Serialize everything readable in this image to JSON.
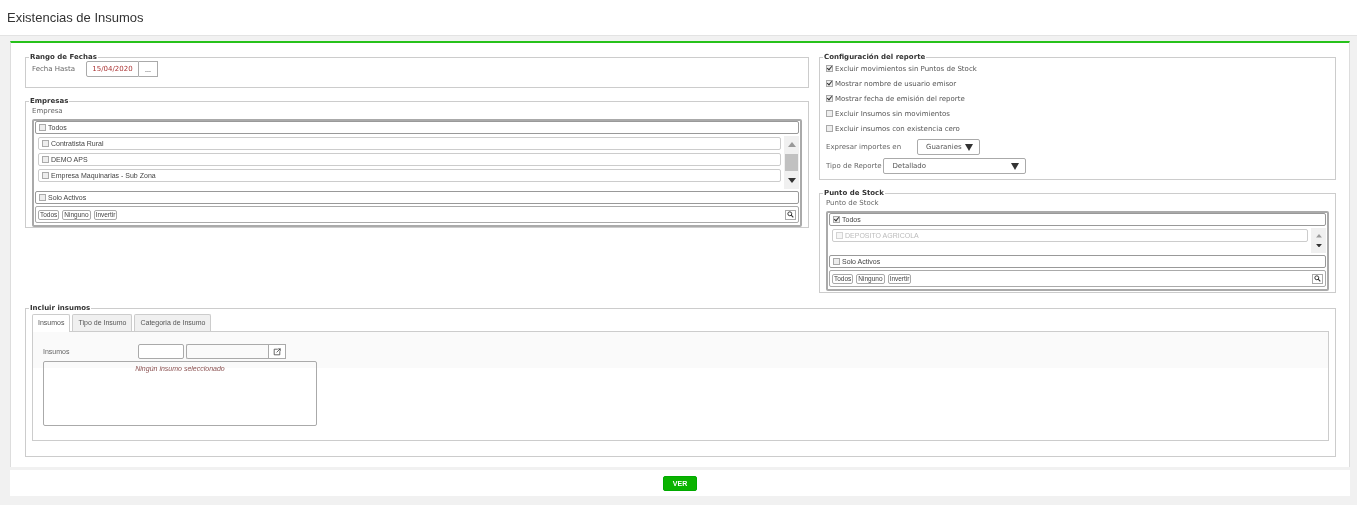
{
  "header": {
    "title": "Existencias de Insumos"
  },
  "rango": {
    "legend": "Rango de Fechas",
    "label": "Fecha Hasta",
    "value": "15/04/2020",
    "button": "..."
  },
  "empresas": {
    "legend": "Empresas",
    "label": "Empresa",
    "all": {
      "label": "Todos",
      "checked": false
    },
    "items": [
      {
        "label": "Contratista Rural",
        "checked": false
      },
      {
        "label": "DEMO APS",
        "checked": false
      },
      {
        "label": "Empresa Maquinarias - Sub Zona",
        "checked": false
      }
    ],
    "solo": {
      "label": "Solo Activos",
      "checked": false
    },
    "buttons": [
      "Todos",
      "Ninguno",
      "Invertir"
    ]
  },
  "config": {
    "legend": "Configuración del reporte",
    "options": [
      {
        "label": "Excluir movimientos sin Puntos de Stock",
        "checked": true
      },
      {
        "label": "Mostrar nombre de usuario emisor",
        "checked": true
      },
      {
        "label": "Mostrar fecha de emisión del reporte",
        "checked": true
      },
      {
        "label": "Excluir Insumos sin movimientos",
        "checked": false
      },
      {
        "label": "Excluir insumos con existencia cero",
        "checked": false
      }
    ],
    "importes": {
      "label": "Expresar importes en",
      "value": "Guaranies"
    },
    "tipo": {
      "label": "Tipo de Reporte",
      "value": "Detallado"
    }
  },
  "punto_stock": {
    "legend": "Punto de Stock",
    "label": "Punto de Stock",
    "all": {
      "label": "Todos",
      "checked": true
    },
    "items": [
      {
        "label": "DEPOSITO AGRICOLA",
        "checked": false,
        "disabled": true
      }
    ],
    "solo": {
      "label": "Solo Activos",
      "checked": false
    },
    "buttons": [
      "Todos",
      "Ninguno",
      "Invertir"
    ]
  },
  "incluir": {
    "legend": "Incluir insumos",
    "tabs": [
      {
        "label": "Insumos",
        "selected": true
      },
      {
        "label": "Tipo de Insumo",
        "selected": false
      },
      {
        "label": "Categoria de Insumo",
        "selected": false
      }
    ],
    "field_label": "Insumos",
    "empty_text": "Ningún insumo seleccionado"
  },
  "footer": {
    "button": "VER"
  }
}
